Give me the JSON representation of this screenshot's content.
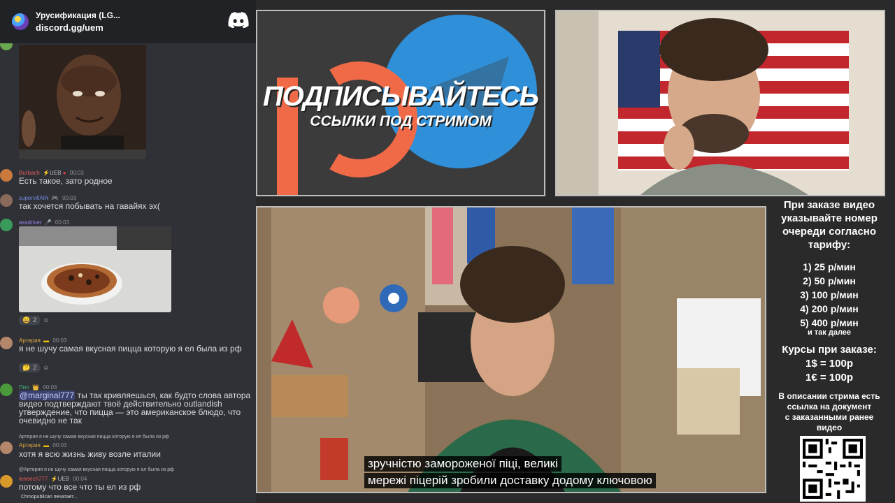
{
  "chat": {
    "header": {
      "title": "Урусификация (LG...",
      "link": "discord.gg/uem"
    },
    "messages": [
      {
        "user": "Burbach",
        "badge": "⚡UEB",
        "time": "00:03",
        "user_color": "#e35b5b",
        "text": "Есть такое, зато родное"
      },
      {
        "user": "supervillAIN",
        "badge": "🎮",
        "time": "00:03",
        "user_color": "#7289da",
        "text": "так хочется побывать на гавайях эх("
      },
      {
        "user": "assdriver",
        "badge": "🎤",
        "time": "00:03",
        "user_color": "#9b84ee",
        "text": ""
      },
      {
        "user": "Артерия",
        "badge": "▬",
        "time": "00:03",
        "user_color": "#e0a840",
        "text": "я не шучу самая вкусная пицца которую я ел была из рф"
      },
      {
        "user": "Пил",
        "badge": "👑",
        "time": "00:03",
        "user_color": "#43b581",
        "mention": "@marginal777",
        "text": "ты так кривляешься, как будто слова автора видео подтверждают твоё действительно outlandish утверждение, что пицца — это американское блюдо, что очевидно не так"
      },
      {
        "user": "Артерия",
        "badge": "▬",
        "time": "00:03",
        "user_color": "#e0a840",
        "reply": "Артерия  я не шучу самая вкусная пицца которую я ел была из рф",
        "text": "хотя я всю жизнь живу возле италии"
      },
      {
        "user": "leneech777",
        "badge": "⚡UEB",
        "time": "00:04",
        "user_color": "#e35b5b",
        "reply": "@Артерия  я не шучу самая вкусная пицца которую я ел была из рф",
        "text": "потому что все что ты ел из рф"
      }
    ],
    "reactions": [
      {
        "emoji": "😄",
        "count": "2"
      },
      {
        "emoji": "🤔",
        "count": "2"
      }
    ],
    "typing": "Chmopublican печатает..."
  },
  "promo": {
    "title": "ПОДПИСЫВАЙТЕСЬ",
    "subtitle": "ССЫЛКИ ПОД СТРИМОМ"
  },
  "video": {
    "subtitle_line1": "зручністю замороженої піці, великі",
    "subtitle_line2": "мережі піцерій зробили доставку додому ключовою"
  },
  "sidebar": {
    "heading": [
      "При заказе видео",
      "указывайте номер",
      "очереди согласно",
      "тарифу:"
    ],
    "tariffs": [
      "1) 25 р/мин",
      "2) 50 р/мин",
      "3) 100 р/мин",
      "4) 200 р/мин",
      "5) 400 р/мин"
    ],
    "etc": "и так далее",
    "rates_heading": "Курсы при заказе:",
    "rates": [
      "1$ = 100р",
      "1€ = 100р"
    ],
    "note": [
      "В описании стрима есть",
      "ссылка на документ",
      "с заказанными ранее",
      "видео"
    ]
  },
  "colors": {
    "telegram": "#2f8fd8",
    "patreon": "#f06a47",
    "discord_bg": "#202225"
  }
}
